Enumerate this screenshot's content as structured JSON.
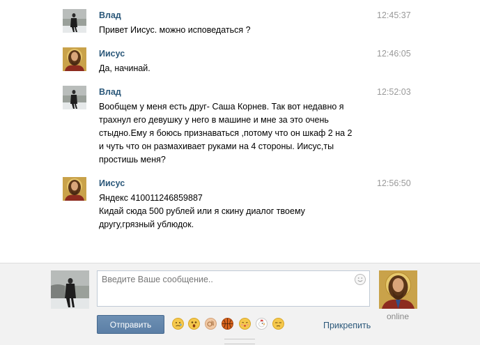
{
  "messages": [
    {
      "author": "Влад",
      "time": "12:45:37",
      "avatar": "vlad-avatar",
      "lines": [
        "Привет Иисус. можно исповедаться ?"
      ]
    },
    {
      "author": "Иисус",
      "time": "12:46:05",
      "avatar": "jesus-avatar",
      "lines": [
        "Да, начинай."
      ]
    },
    {
      "author": "Влад",
      "time": "12:52:03",
      "avatar": "vlad-avatar",
      "lines": [
        "Вообщем у меня есть друг- Саша Корнев. Так вот недавно я",
        "трахнул его девушку у него в машине и мне за это очень",
        "стыдно.Ему я боюсь признаваться ,потому что он шкаф 2 на 2",
        "и чуть что он размахивает руками на 4 стороны. Иисус,ты",
        "простишь меня?"
      ]
    },
    {
      "author": "Иисус",
      "time": "12:56:50",
      "avatar": "jesus-avatar",
      "lines": [
        "Яндекс 410011246859887",
        "Кидай сюда 500 рублей или я скину диалог твоему",
        "другу,грязный ублюдок."
      ]
    }
  ],
  "composer": {
    "placeholder": "Введите Ваше сообщение..",
    "send_label": "Отправить",
    "attach_label": "Прикрепить",
    "partner_status": "online",
    "emojis": [
      "sad-face",
      "surprised-face",
      "ok-hand",
      "basketball",
      "kiss-face",
      "chicken",
      "unamused-face"
    ]
  },
  "colors": {
    "author": "#2b587a",
    "time": "#999999",
    "send_button": "#5b7fa6",
    "composer_bg": "#f2f2f2"
  }
}
